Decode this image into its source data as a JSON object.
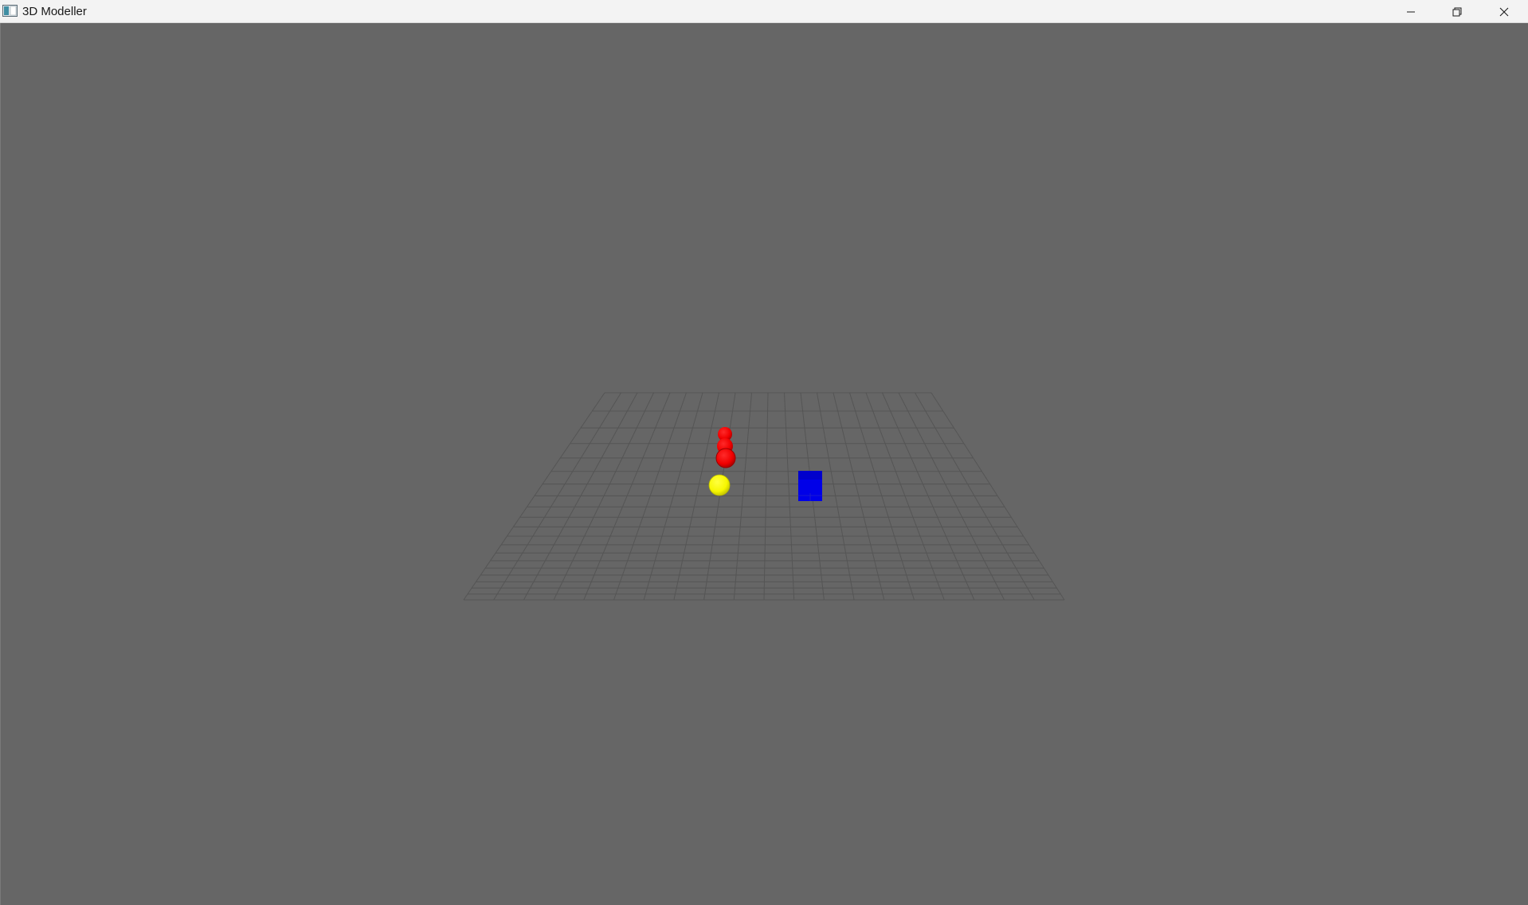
{
  "window": {
    "title": "3D Modeller",
    "controls": {
      "minimize_icon": "minimize-icon",
      "restore_icon": "restore-icon",
      "close_icon": "close-icon"
    }
  },
  "viewport": {
    "background_color": "#666666",
    "grid": {
      "visible": true,
      "color": "#555555",
      "divisions": 20
    },
    "objects": [
      {
        "type": "sphere",
        "color": "#ff0000"
      },
      {
        "type": "sphere",
        "color": "#ff0000"
      },
      {
        "type": "sphere",
        "color": "#ff0000"
      },
      {
        "type": "sphere",
        "color": "#ffff00"
      },
      {
        "type": "cube",
        "color": "#0000ff"
      }
    ]
  }
}
